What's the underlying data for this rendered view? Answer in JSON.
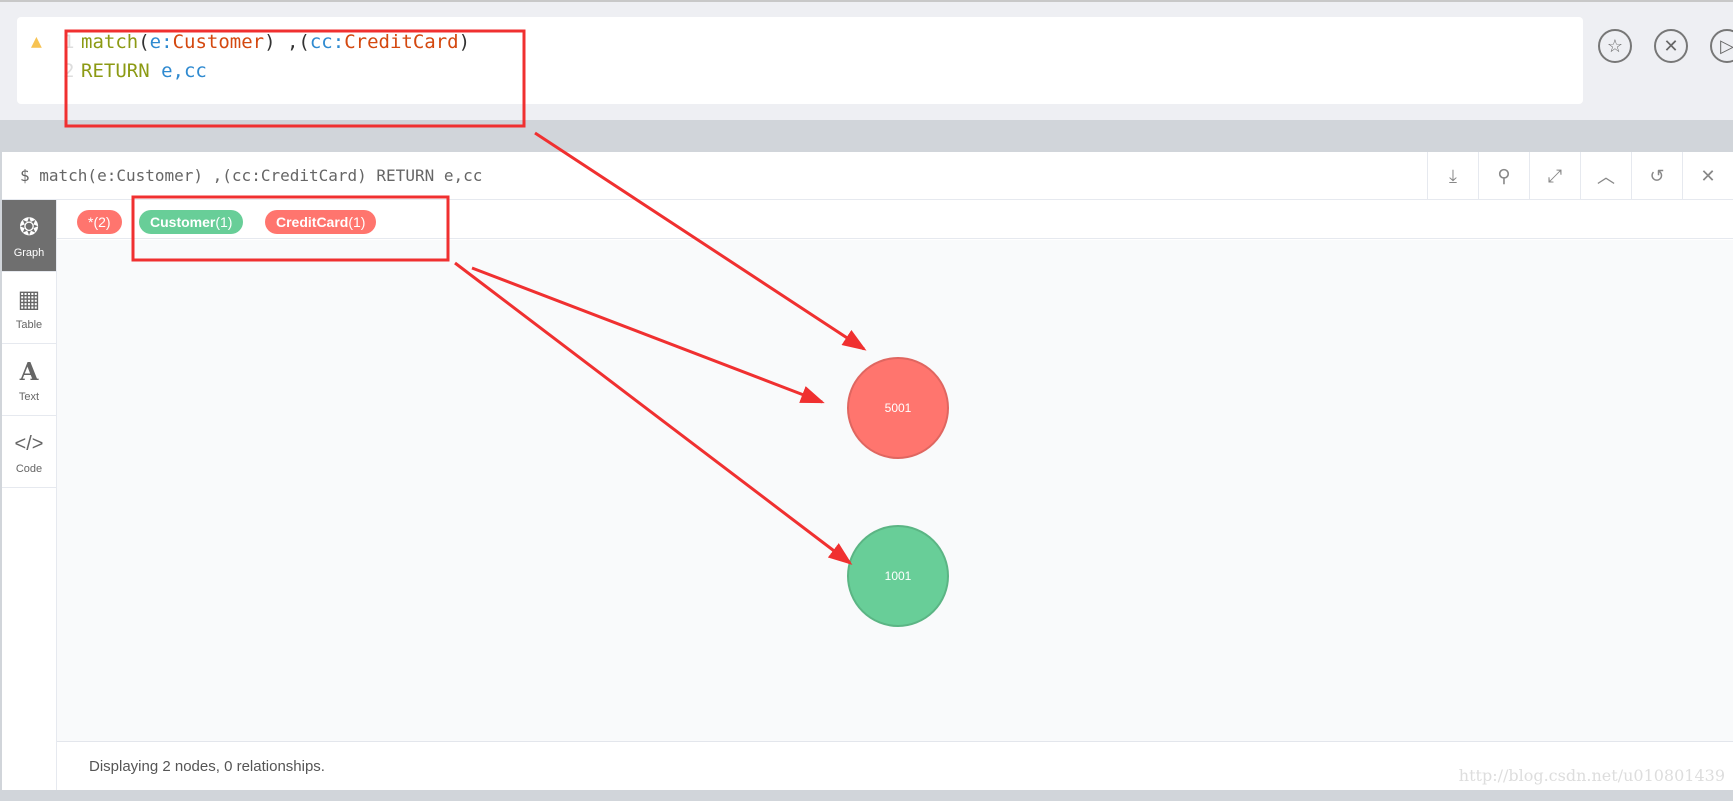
{
  "editor": {
    "line_numbers": [
      "1",
      "2"
    ],
    "line1": {
      "kw": "match",
      "open": "(",
      "v1": "e",
      "colon1": ":",
      "l1": "Customer",
      "mid": ") ,(",
      "v2": "cc",
      "colon2": ":",
      "l2": "CreditCard",
      "close": ")"
    },
    "line2": {
      "kw": "RETURN",
      "vars": "e,cc"
    },
    "buttons": {
      "favorite": "star-icon",
      "clear": "close-circle-icon",
      "run": "play-icon"
    }
  },
  "result": {
    "query": "$ match(e:Customer) ,(cc:CreditCard) RETURN e,cc",
    "tools": [
      "download-icon",
      "pin-icon",
      "expand-icon",
      "collapse-icon",
      "rerun-icon",
      "close-icon"
    ],
    "sidebar": [
      {
        "label": "Graph",
        "icon": "graph-icon",
        "active": true
      },
      {
        "label": "Table",
        "icon": "table-icon"
      },
      {
        "label": "Text",
        "icon": "text-icon"
      },
      {
        "label": "Code",
        "icon": "code-icon"
      }
    ],
    "pills": [
      {
        "name": "*",
        "count": "(2)",
        "color": "#ff756e"
      },
      {
        "name": "Customer",
        "count": "(1)",
        "color": "#68ce98"
      },
      {
        "name": "CreditCard",
        "count": "(1)",
        "color": "#ff756e"
      }
    ],
    "nodes": [
      {
        "label": "5001",
        "color": "#ff756e",
        "border": "#e06660"
      },
      {
        "label": "1001",
        "color": "#68ce98",
        "border": "#5bb584"
      }
    ],
    "status": "Displaying 2 nodes, 0 relationships.",
    "watermark": "http://blog.csdn.net/u010801439"
  },
  "colors": {
    "annotation": "#f03030"
  }
}
